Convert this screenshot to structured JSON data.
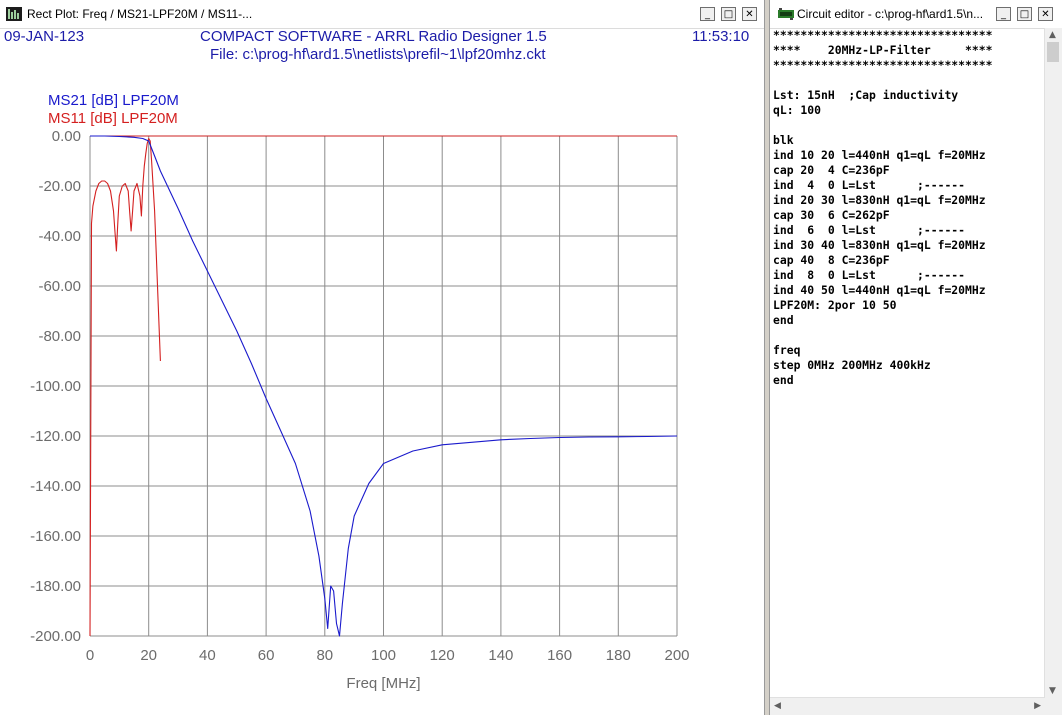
{
  "plot_window": {
    "title": "Rect Plot: Freq / MS21-LPF20M / MS11-...",
    "date": "09-JAN-123",
    "header_line1": "COMPACT SOFTWARE - ARRL Radio Designer 1.5",
    "header_line2": "File: c:\\prog-hf\\ard1.5\\netlists\\prefil~1\\lpf20mhz.ckt",
    "time": "11:53:10",
    "buttons": {
      "minimize": "_",
      "maximize": "□",
      "close": "✕"
    }
  },
  "editor_window": {
    "title": "Circuit editor - c:\\prog-hf\\ard1.5\\n...",
    "buttons": {
      "minimize": "_",
      "maximize": "□",
      "close": "✕"
    },
    "lines": [
      "********************************",
      "****    20MHz-LP-Filter     ****",
      "********************************",
      "",
      "Lst: 15nH  ;Cap inductivity",
      "qL: 100",
      "",
      "blk",
      "ind 10 20 l=440nH q1=qL f=20MHz",
      "cap 20  4 C=236pF",
      "ind  4  0 L=Lst      ;------",
      "ind 20 30 l=830nH q1=qL f=20MHz",
      "cap 30  6 C=262pF",
      "ind  6  0 l=Lst      ;------",
      "ind 30 40 l=830nH q1=qL f=20MHz",
      "cap 40  8 C=236pF",
      "ind  8  0 L=Lst      ;------",
      "ind 40 50 l=440nH q1=qL f=20MHz",
      "LPF20M: 2por 10 50",
      "end",
      "",
      "freq",
      "step 0MHz 200MHz 400kHz",
      "end"
    ]
  },
  "chart_data": {
    "type": "line",
    "xlabel": "Freq [MHz]",
    "ylabel": "",
    "xlim": [
      0,
      200
    ],
    "ylim": [
      -200,
      0
    ],
    "xticks": [
      "0",
      "20",
      "40",
      "60",
      "80",
      "100",
      "120",
      "140",
      "160",
      "180",
      "200"
    ],
    "yticks": [
      "0.00",
      "-20.00",
      "-40.00",
      "-60.00",
      "-80.00",
      "-100.00",
      "-120.00",
      "-140.00",
      "-160.00",
      "-180.00",
      "-200.00"
    ],
    "grid": true,
    "legend_position": "top-left",
    "colors": {
      "MS21": "#1a1acc",
      "MS11": "#d42020",
      "grid": "#8c8c8c",
      "zero_line": "#cc2020"
    },
    "series": [
      {
        "name": "MS21 [dB] LPF20M",
        "key": "MS21",
        "x": [
          0,
          5,
          10,
          15,
          18,
          20,
          22,
          24,
          26,
          28,
          30,
          35,
          40,
          45,
          50,
          55,
          60,
          65,
          70,
          75,
          78,
          80,
          81,
          82,
          83,
          84,
          85,
          86,
          88,
          90,
          95,
          100,
          110,
          120,
          130,
          140,
          150,
          160,
          170,
          180,
          190,
          200
        ],
        "y": [
          0,
          0,
          -0.2,
          -0.5,
          -1,
          -2,
          -8,
          -14,
          -19,
          -24,
          -29,
          -42,
          -54,
          -66,
          -78,
          -91,
          -105,
          -118,
          -131,
          -150,
          -168,
          -185,
          -197,
          -180,
          -182,
          -195,
          -200,
          -187,
          -165,
          -152,
          -139,
          -131,
          -126,
          -123.5,
          -122.5,
          -121.5,
          -121,
          -120.6,
          -120.4,
          -120.3,
          -120.2,
          -120
        ]
      },
      {
        "name": "MS11 [dB] LPF20M",
        "key": "MS11",
        "x": [
          0,
          0.5,
          1,
          2,
          3,
          4,
          5,
          6,
          7,
          8,
          8.5,
          9,
          9.5,
          10,
          11,
          12,
          13,
          13.5,
          14,
          14.5,
          15,
          16,
          17,
          17.5,
          18,
          18.5,
          19,
          19.5,
          20,
          20.5,
          21,
          22,
          23,
          24
        ],
        "y": [
          -200,
          -35,
          -28,
          -22,
          -19,
          -18,
          -18,
          -19,
          -22,
          -30,
          -38,
          -46,
          -34,
          -24,
          -20,
          -19,
          -22,
          -30,
          -38,
          -30,
          -22,
          -19,
          -24,
          -32,
          -20,
          -12,
          -7,
          -3,
          -1,
          -2,
          -10,
          -30,
          -60,
          -90
        ]
      }
    ]
  }
}
